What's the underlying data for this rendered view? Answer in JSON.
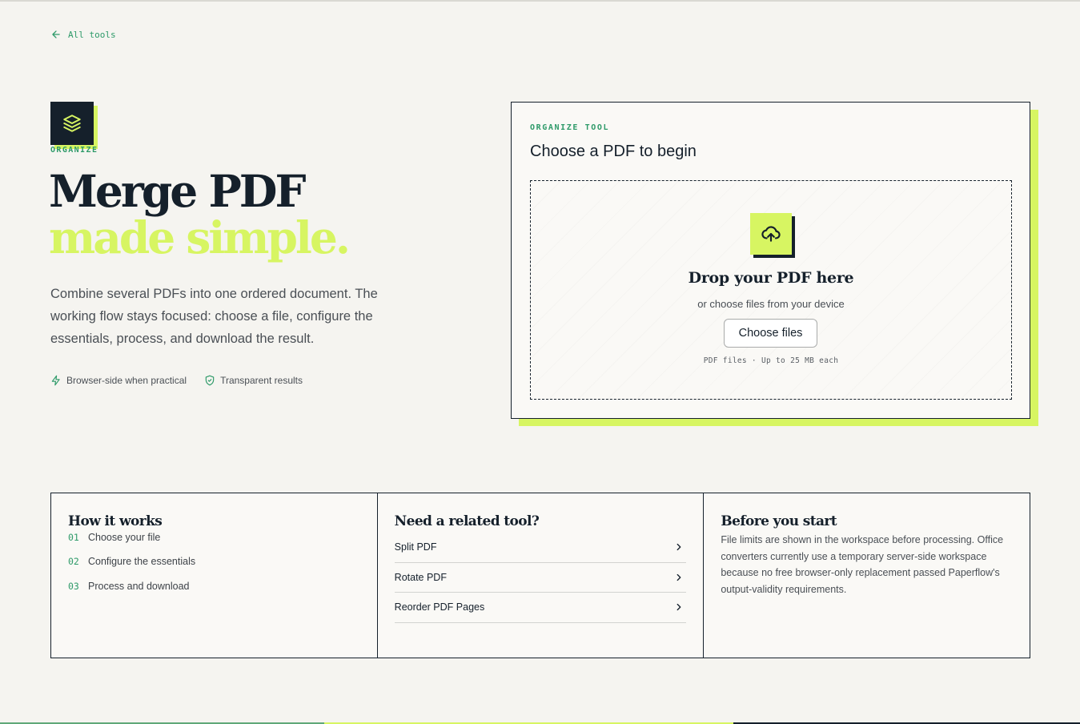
{
  "nav": {
    "back_label": "All tools"
  },
  "hero": {
    "category": "ORGANIZE",
    "title_line1": "Merge PDF",
    "title_line2": "made simple.",
    "description": "Combine several PDFs into one ordered document. The working flow stays focused: choose a file, configure the essentials, process, and download the result.",
    "features": [
      {
        "label": "Browser-side when practical",
        "icon": "bolt-icon"
      },
      {
        "label": "Transparent results",
        "icon": "shield-check-icon"
      }
    ]
  },
  "upload_card": {
    "eyebrow": "ORGANIZE TOOL",
    "title": "Choose a PDF to begin",
    "drop_title": "Drop your PDF here",
    "drop_subtitle": "or choose files from your device",
    "choose_button": "Choose files",
    "limits": "PDF files · Up to 25 MB each"
  },
  "how_it_works": {
    "title": "How it works",
    "steps": [
      {
        "num": "01",
        "label": "Choose your file"
      },
      {
        "num": "02",
        "label": "Configure the essentials"
      },
      {
        "num": "03",
        "label": "Process and download"
      }
    ]
  },
  "related_tools": {
    "title": "Need a related tool?",
    "items": [
      {
        "label": "Split PDF"
      },
      {
        "label": "Rotate PDF"
      },
      {
        "label": "Reorder PDF Pages"
      }
    ]
  },
  "before_you_start": {
    "title": "Before you start",
    "text": "File limits are shown in the workspace before processing. Office converters currently use a temporary server-side workspace because no free browser-only replacement passed Paperflow's output-validity requirements."
  },
  "colors": {
    "accent_lime": "#d7f562",
    "accent_green": "#2e9a69",
    "ink": "#15202b",
    "background": "#f5f4f0"
  }
}
